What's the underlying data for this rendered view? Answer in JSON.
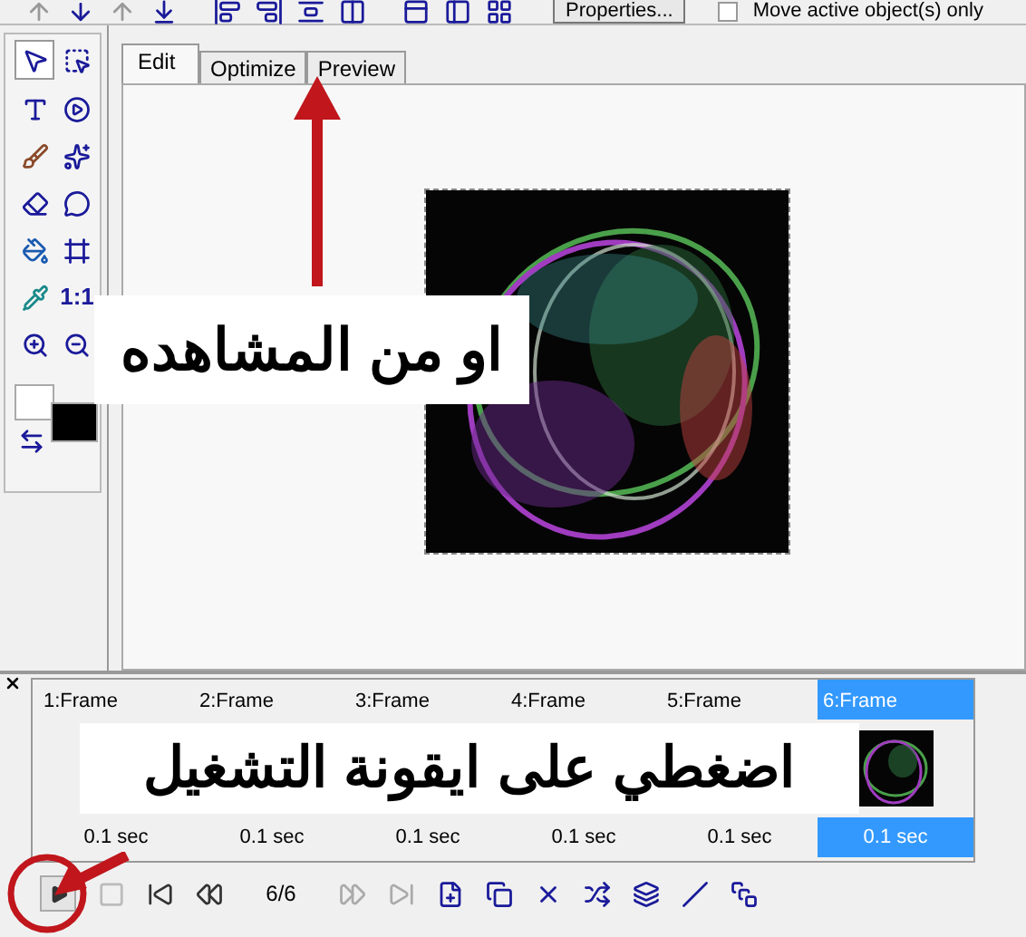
{
  "toolbar": {
    "properties_button": "Properties...",
    "move_checkbox": {
      "label": "Move active object(s) only",
      "checked": false
    }
  },
  "tool_palette": {
    "ratio_label": "1:1"
  },
  "tabs": [
    {
      "label": "Edit",
      "selected": true
    },
    {
      "label": "Optimize",
      "selected": false
    },
    {
      "label": "Preview",
      "selected": false
    }
  ],
  "animation": {
    "frames": [
      {
        "label": "1:Frame",
        "delay": "0.1 sec",
        "selected": false
      },
      {
        "label": "2:Frame",
        "delay": "0.1 sec",
        "selected": false
      },
      {
        "label": "3:Frame",
        "delay": "0.1 sec",
        "selected": false
      },
      {
        "label": "4:Frame",
        "delay": "0.1 sec",
        "selected": false
      },
      {
        "label": "5:Frame",
        "delay": "0.1 sec",
        "selected": false
      },
      {
        "label": "6:Frame",
        "delay": "0.1 sec",
        "selected": true
      }
    ],
    "frame_counter": "6/6"
  },
  "annotations": [
    {
      "text": "او من المشاهده"
    },
    {
      "text": "اضغطي على ايقونة التشغيل"
    }
  ]
}
